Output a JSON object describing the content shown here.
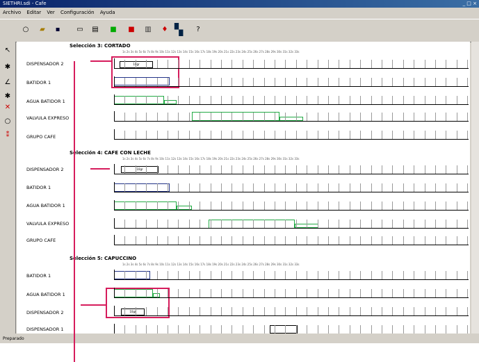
{
  "window": {
    "title": "SIETHRI.sdi - Cafe",
    "controls": "_ □ ×"
  },
  "menu": [
    "Archivo",
    "Editar",
    "Ver",
    "Configuración",
    "Ayuda"
  ],
  "toolbar_icons": [
    "open-icon",
    "folder-icon",
    "save-icon",
    "preview-icon",
    "print-icon",
    "green-run-icon",
    "red-stop-icon",
    "list-icon",
    "paint-icon",
    "book-icon",
    "help-icon"
  ],
  "palette_icons": [
    "arrow-icon",
    "node-icon",
    "edit-icon",
    "node2-icon",
    "delete-icon",
    "circle-icon",
    "signal-icon"
  ],
  "time_labels": "1s 2s 3s 4s 5s 6s 7s 8s 9s 10s 11s 12s 13s 14s 15s 16s 17s 18s 19s 20s 21s 22s 23s 24s 25s 26s 27s 28s 29s 30s 31s 32s 33s",
  "sections": [
    {
      "title": "Selección 3: CORTADO",
      "rows": [
        "DISPENSADOR 2",
        "BATIDOR 1",
        "AGUA BATIDOR 1",
        "VALVULA EXPRESO",
        "GRUPO CAFE"
      ]
    },
    {
      "title": "Selección 4: CAFE CON LECHE",
      "rows": [
        "DISPENSADOR 2",
        "BATIDOR 1",
        "AGUA BATIDOR 1",
        "VALVULA EXPRESO",
        "GRUPO CAFE"
      ]
    },
    {
      "title": "Selección 5: CAPUCCINO",
      "rows": [
        "BATIDOR 1",
        "AGUA BATIDOR 1",
        "DISPENSADOR 2",
        "DISPENSADOR 1"
      ]
    }
  ],
  "bar_labels": {
    "s3_dispensador": "10gr",
    "s4_dispensador": "10gr",
    "s5_dispensador": "10gr"
  },
  "status": "Preparado",
  "colors": {
    "annotation": "#d61c5c",
    "blue_bar": "#223388",
    "green_bar": "#22aa44"
  }
}
